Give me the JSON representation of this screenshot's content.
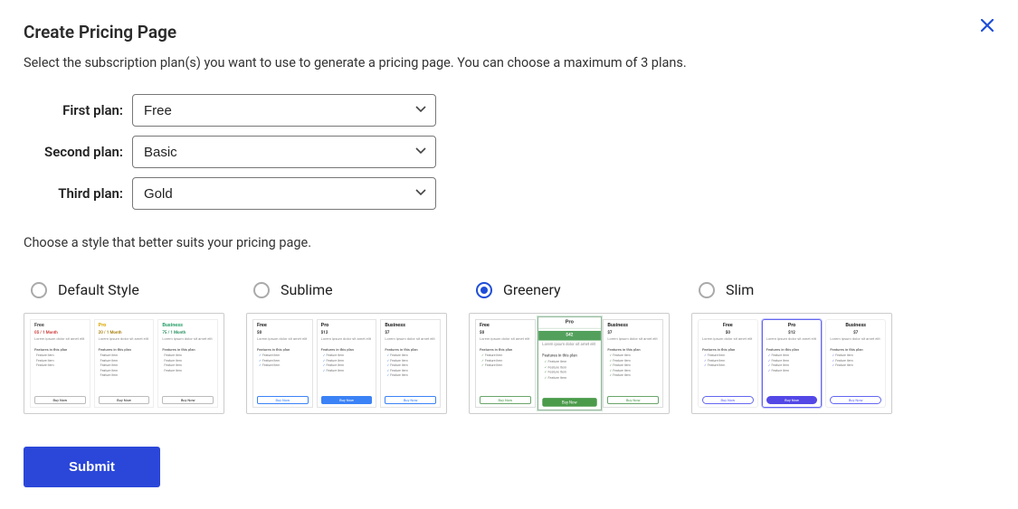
{
  "header": {
    "title": "Create Pricing Page",
    "subtitle": "Select the subscription plan(s) you want to use to generate a pricing page. You can choose a maximum of 3 plans.",
    "close_icon": "close-icon"
  },
  "plan_selects": {
    "first": {
      "label": "First plan:",
      "value": "Free",
      "options": [
        "Free",
        "Basic",
        "Gold"
      ]
    },
    "second": {
      "label": "Second plan:",
      "value": "Basic",
      "options": [
        "Free",
        "Basic",
        "Gold"
      ]
    },
    "third": {
      "label": "Third plan:",
      "value": "Gold",
      "options": [
        "Free",
        "Basic",
        "Gold"
      ]
    }
  },
  "style_heading": "Choose a style that better suits your pricing page.",
  "styles": {
    "selected": "greenery",
    "items": [
      {
        "key": "default",
        "label": "Default Style"
      },
      {
        "key": "sublime",
        "label": "Sublime"
      },
      {
        "key": "greenery",
        "label": "Greenery"
      },
      {
        "key": "slim",
        "label": "Slim"
      }
    ]
  },
  "preview_tiers": {
    "default": [
      {
        "title": "Free",
        "subtitle": "0$ / 1 Month",
        "features": 3,
        "btn": "Buy Now"
      },
      {
        "title": "Pro",
        "subtitle": "20 / 1 Month",
        "features": 5,
        "btn": "Buy Now"
      },
      {
        "title": "Business",
        "subtitle": "75 / 1 Month",
        "features": 4,
        "btn": "Buy Now"
      }
    ],
    "sublime": [
      {
        "title": "Free",
        "subtitle": "$0",
        "features": 3,
        "btn": "Buy Now"
      },
      {
        "title": "Pro",
        "subtitle": "$12",
        "features": 4,
        "btn": "Buy Now"
      },
      {
        "title": "Business",
        "subtitle": "$7",
        "features": 5,
        "btn": "Buy Now"
      }
    ],
    "greenery": [
      {
        "title": "Free",
        "subtitle": "$0",
        "features": 3,
        "btn": "Buy Now"
      },
      {
        "title": "Pro",
        "subtitle": "$42",
        "features": 4,
        "btn": "Buy Now"
      },
      {
        "title": "Business",
        "subtitle": "$7",
        "features": 5,
        "btn": "Buy Now"
      }
    ],
    "slim": [
      {
        "title": "Free",
        "subtitle": "$0",
        "features": 3,
        "btn": "Buy Now"
      },
      {
        "title": "Pro",
        "subtitle": "$12",
        "features": 4,
        "btn": "Buy Now"
      },
      {
        "title": "Business",
        "subtitle": "$7",
        "features": 3,
        "btn": "Buy Now"
      }
    ]
  },
  "actions": {
    "submit_label": "Submit"
  },
  "colors": {
    "primary": "#2b47d9",
    "radio_selected": "#1e4ed8",
    "greenery": "#4b9b4b",
    "slim_accent": "#5348e6",
    "sublime_accent": "#3b82f6"
  }
}
